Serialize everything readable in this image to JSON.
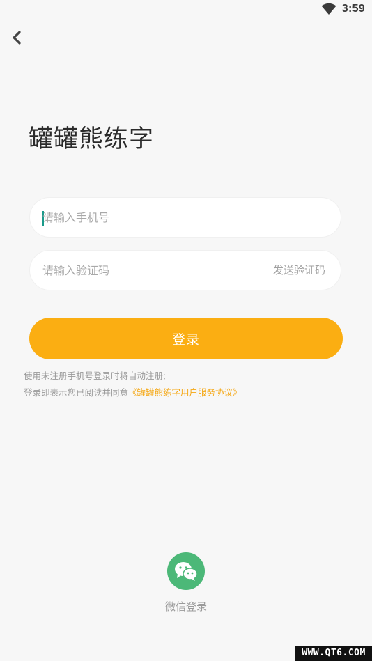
{
  "status_bar": {
    "time": "3:59",
    "wifi_icon": "wifi-icon"
  },
  "nav": {
    "back_icon": "chevron-left-icon"
  },
  "app_title": "罐罐熊练字",
  "form": {
    "phone_placeholder": "请输入手机号",
    "code_placeholder": "请输入验证码",
    "send_code_label": "发送验证码",
    "login_label": "登录"
  },
  "notes": {
    "line1": "使用未注册手机号登录时将自动注册;",
    "line2_prefix": "登录即表示您已阅读并同意",
    "agreement_link": "《罐罐熊练字用户服务协议》"
  },
  "social_login": {
    "wechat_icon": "wechat-icon",
    "wechat_label": "微信登录"
  },
  "watermark": "WWW.QT6.COM",
  "colors": {
    "accent": "#fbae12",
    "link": "#f5a712",
    "wechat": "#4cb878",
    "background": "#f7f7f7",
    "caret": "#1a9a8a"
  }
}
